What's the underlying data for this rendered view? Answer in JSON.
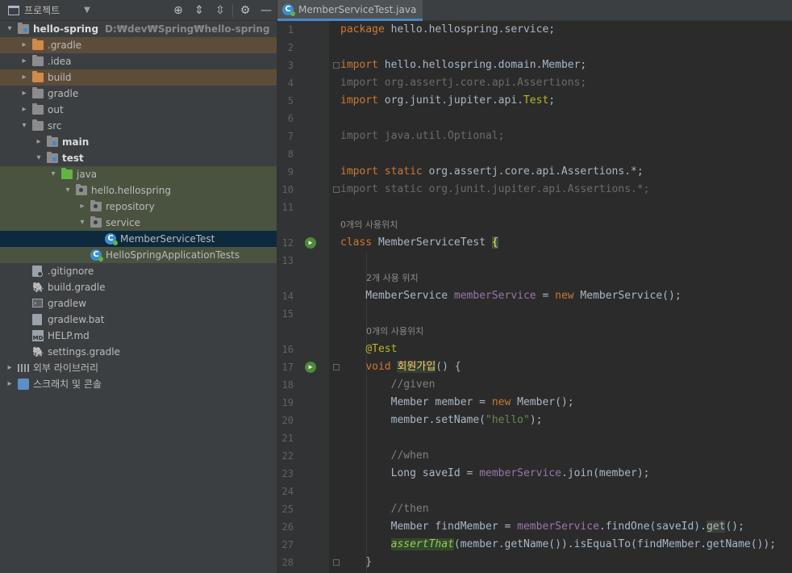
{
  "sidebar": {
    "header_title": "프로젝트",
    "tree": [
      {
        "label": "hello-spring",
        "path": "D:₩dev₩Spring₩hello-spring",
        "bold": true,
        "arrow": "▾",
        "icon": "folder-module-icon",
        "depth": 0
      },
      {
        "label": ".gradle",
        "arrow": "▸",
        "icon": "folder-icon",
        "depth": 1,
        "color": "orange",
        "hl": "build"
      },
      {
        "label": ".idea",
        "arrow": "▸",
        "icon": "folder-icon",
        "depth": 1
      },
      {
        "label": "build",
        "arrow": "▸",
        "icon": "folder-icon",
        "depth": 1,
        "color": "orange",
        "hl": "build"
      },
      {
        "label": "gradle",
        "arrow": "▸",
        "icon": "folder-icon",
        "depth": 1
      },
      {
        "label": "out",
        "arrow": "▸",
        "icon": "folder-icon",
        "depth": 1
      },
      {
        "label": "src",
        "arrow": "▾",
        "icon": "folder-icon",
        "depth": 1
      },
      {
        "label": "main",
        "arrow": "▸",
        "icon": "folder-module-icon",
        "depth": 2,
        "bold": true
      },
      {
        "label": "test",
        "arrow": "▾",
        "icon": "folder-module-icon",
        "depth": 2,
        "bold": true
      },
      {
        "label": "java",
        "arrow": "▾",
        "icon": "folder-icon",
        "depth": 3,
        "color": "green",
        "hl": "test"
      },
      {
        "label": "hello.hellospring",
        "arrow": "▾",
        "icon": "package-icon",
        "depth": 4,
        "hl": "test"
      },
      {
        "label": "repository",
        "arrow": "▸",
        "icon": "package-icon",
        "depth": 5,
        "hl": "test"
      },
      {
        "label": "service",
        "arrow": "▾",
        "icon": "package-icon",
        "depth": 5,
        "hl": "test"
      },
      {
        "label": "MemberServiceTest",
        "arrow": "",
        "icon": "test-class-icon",
        "depth": 6,
        "selected": true
      },
      {
        "label": "HelloSpringApplicationTests",
        "arrow": "",
        "icon": "test-class-icon",
        "depth": 5,
        "hl": "test"
      },
      {
        "label": ".gitignore",
        "arrow": "",
        "icon": "gitignore-file-icon",
        "depth": 1
      },
      {
        "label": "build.gradle",
        "arrow": "",
        "icon": "gradle-icon",
        "depth": 1
      },
      {
        "label": "gradlew",
        "arrow": "",
        "icon": "terminal-file-icon",
        "depth": 1
      },
      {
        "label": "gradlew.bat",
        "arrow": "",
        "icon": "text-file-icon",
        "depth": 1
      },
      {
        "label": "HELP.md",
        "arrow": "",
        "icon": "markdown-file-icon",
        "depth": 1
      },
      {
        "label": "settings.gradle",
        "arrow": "",
        "icon": "gradle-icon",
        "depth": 1
      },
      {
        "label": "외부 라이브러리",
        "arrow": "▸",
        "icon": "library-icon",
        "depth": 0
      },
      {
        "label": "스크래치 및 콘솔",
        "arrow": "▸",
        "icon": "scratch-icon",
        "depth": 0
      }
    ]
  },
  "tab": {
    "label": "MemberServiceTest.java"
  },
  "editor": {
    "lines": [
      {
        "n": "1",
        "html": "<span class='kw'>package</span> hello.hellospring.service;"
      },
      {
        "n": "2",
        "html": ""
      },
      {
        "n": "3",
        "html": "<span class='kw'>import</span> hello.hellospring.domain.Member;",
        "fold": true
      },
      {
        "n": "4",
        "html": "<span class='dim'>import org.assertj.core.api.Assertions;</span>"
      },
      {
        "n": "5",
        "html": "<span class='kw'>import</span> org.junit.jupiter.api.<span class='ann'>Test</span>;"
      },
      {
        "n": "6",
        "html": ""
      },
      {
        "n": "7",
        "html": "<span class='dim'>import java.util.Optional;</span>"
      },
      {
        "n": "8",
        "html": ""
      },
      {
        "n": "9",
        "html": "<span class='kw'>import static</span> org.assertj.core.api.Assertions.*;"
      },
      {
        "n": "10",
        "html": "<span class='dim'>import static org.junit.jupiter.api.Assertions.*;</span>",
        "fold": true
      },
      {
        "n": "11",
        "html": ""
      },
      {
        "n": "",
        "hint": "0개의 사용위치",
        "indent": 0
      },
      {
        "n": "12",
        "html": "<span class='kw'>class</span> MemberServiceTest <span class='hl-brace'>{</span>",
        "run": true
      },
      {
        "n": "13",
        "html": ""
      },
      {
        "n": "",
        "hint": "2개 사용 위치",
        "indent": 4
      },
      {
        "n": "14",
        "html": "    MemberService <span class='fld'>memberService</span> = <span class='kw'>new</span> MemberService();"
      },
      {
        "n": "15",
        "html": ""
      },
      {
        "n": "",
        "hint": "0개의 사용위치",
        "indent": 4
      },
      {
        "n": "16",
        "html": "    <span class='ann'>@Test</span>"
      },
      {
        "n": "17",
        "html": "    <span class='kw'>void</span> <span class='hl-method'>회원가입</span>() {",
        "run": true,
        "fold": true
      },
      {
        "n": "18",
        "html": "        <span class='cmt'>//given</span>"
      },
      {
        "n": "19",
        "html": "        Member member = <span class='kw'>new</span> Member();"
      },
      {
        "n": "20",
        "html": "        member.setName(<span class='str'>\"hello\"</span>);"
      },
      {
        "n": "21",
        "html": ""
      },
      {
        "n": "22",
        "html": "        <span class='cmt'>//when</span>"
      },
      {
        "n": "23",
        "html": "        Long saveId = <span class='fld'>memberService</span>.join(member);"
      },
      {
        "n": "24",
        "html": ""
      },
      {
        "n": "25",
        "html": "        <span class='cmt'>//then</span>"
      },
      {
        "n": "26",
        "html": "        Member findMember = <span class='fld'>memberService</span>.findOne(saveId).<span class='hl-get'>get</span>();"
      },
      {
        "n": "27",
        "html": "        <span class='hl-assert'>assertThat</span>(member.getName()).isEqualTo(findMember.getName());"
      },
      {
        "n": "28",
        "html": "    }",
        "fold": true
      }
    ]
  }
}
